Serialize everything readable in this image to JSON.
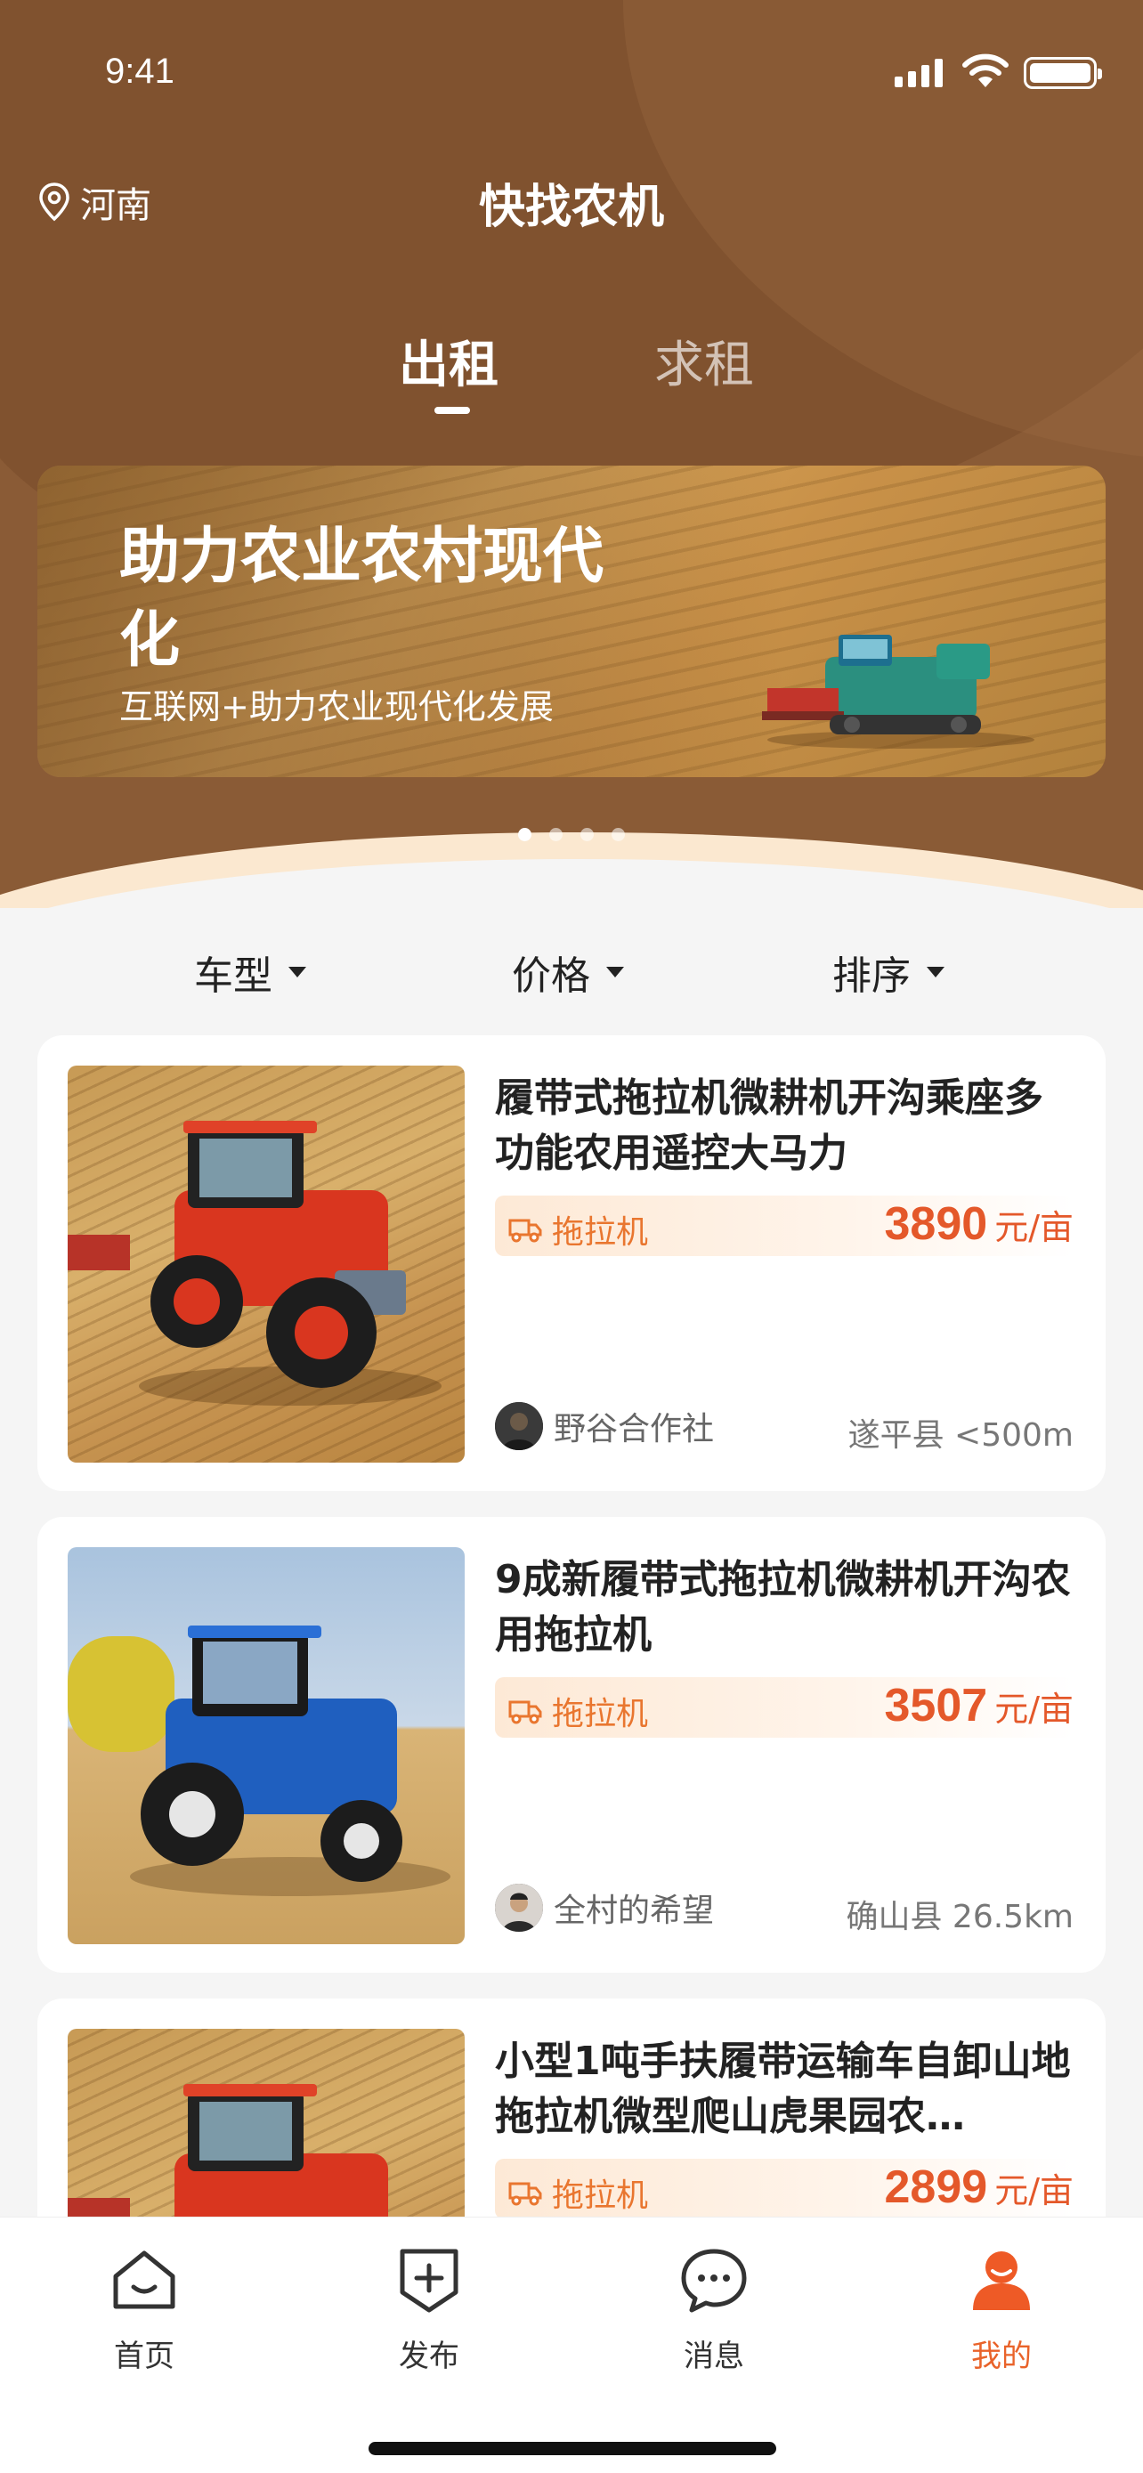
{
  "status_bar": {
    "time": "9:41"
  },
  "header": {
    "location": "河南",
    "title": "快找农机",
    "tabs": [
      {
        "label": "出租",
        "active": true
      },
      {
        "label": "求租",
        "active": false
      }
    ]
  },
  "banner": {
    "title": "助力农业农村现代化",
    "subtitle": "互联网+助力农业现代化发展",
    "page_count": 4,
    "active_page": 1
  },
  "filters": [
    {
      "label": "车型"
    },
    {
      "label": "价格"
    },
    {
      "label": "排序"
    }
  ],
  "listings": [
    {
      "title": "履带式拖拉机微耕机开沟乘座多功能农用遥控大马力",
      "tag": "拖拉机",
      "price": "3890",
      "unit": "元/亩",
      "seller": "野谷合作社",
      "location": "遂平县 <500m",
      "image": "red-tractor"
    },
    {
      "title": "9成新履带式拖拉机微耕机开沟农用拖拉机",
      "tag": "拖拉机",
      "price": "3507",
      "unit": "元/亩",
      "seller": "全村的希望",
      "location": "确山县 26.5km",
      "image": "blue-tractor"
    },
    {
      "title": "小型1吨手扶履带运输车自卸山地拖拉机微型爬山虎果园农…",
      "tag": "拖拉机",
      "price": "2899",
      "unit": "元/亩",
      "image": "red-tractor"
    }
  ],
  "tabbar": [
    {
      "label": "首页",
      "icon": "home-icon",
      "active": false
    },
    {
      "label": "发布",
      "icon": "publish-icon",
      "active": false
    },
    {
      "label": "消息",
      "icon": "message-icon",
      "active": false
    },
    {
      "label": "我的",
      "icon": "profile-icon",
      "active": true
    }
  ],
  "colors": {
    "brand_brown": "#8a5b36",
    "accent_orange": "#e4582a"
  }
}
